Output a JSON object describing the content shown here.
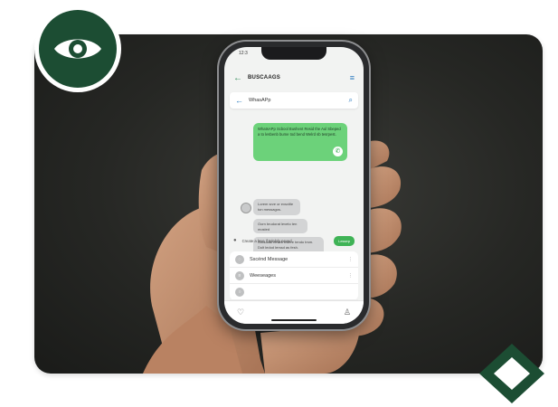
{
  "status": {
    "time": "12:3"
  },
  "appbar": {
    "title": "BUSCAAGS",
    "back_icon": "arrow-left-icon",
    "menu_icon": "menu-icon"
  },
  "search": {
    "value": "WhasAPp",
    "back_icon": "arrow-left-icon",
    "search_icon": "search-icon"
  },
  "chat": {
    "outgoing": "WhatsAPp Scbool Bushent Resid the Aul Sbeped a to lesbenb bume tod bend Welrd sb tesrpest.",
    "incoming": [
      "Lorem srve or exsvitle ton messagos.",
      "Oorn brudorat leveto ten mosted",
      "Ooduidal heveb bwere tendo trsm. Dolt ledod lerssd as fesh."
    ]
  },
  "composer": {
    "placeholder": "Create a leve if telololy neved",
    "button": "Lessep"
  },
  "list": [
    {
      "label": "Sscénd Message",
      "icon": "chat-icon"
    },
    {
      "label": "Weeseages",
      "icon": "list-icon"
    },
    {
      "label": "",
      "icon": "circle-icon"
    }
  ],
  "tabbar": {
    "left_icon": "heart-icon",
    "right_icon": "profile-icon"
  },
  "colors": {
    "brand": "#1c4d33",
    "whatsapp": "#6cd27a",
    "accent": "#2a7abf",
    "card_bg": "#262724"
  }
}
